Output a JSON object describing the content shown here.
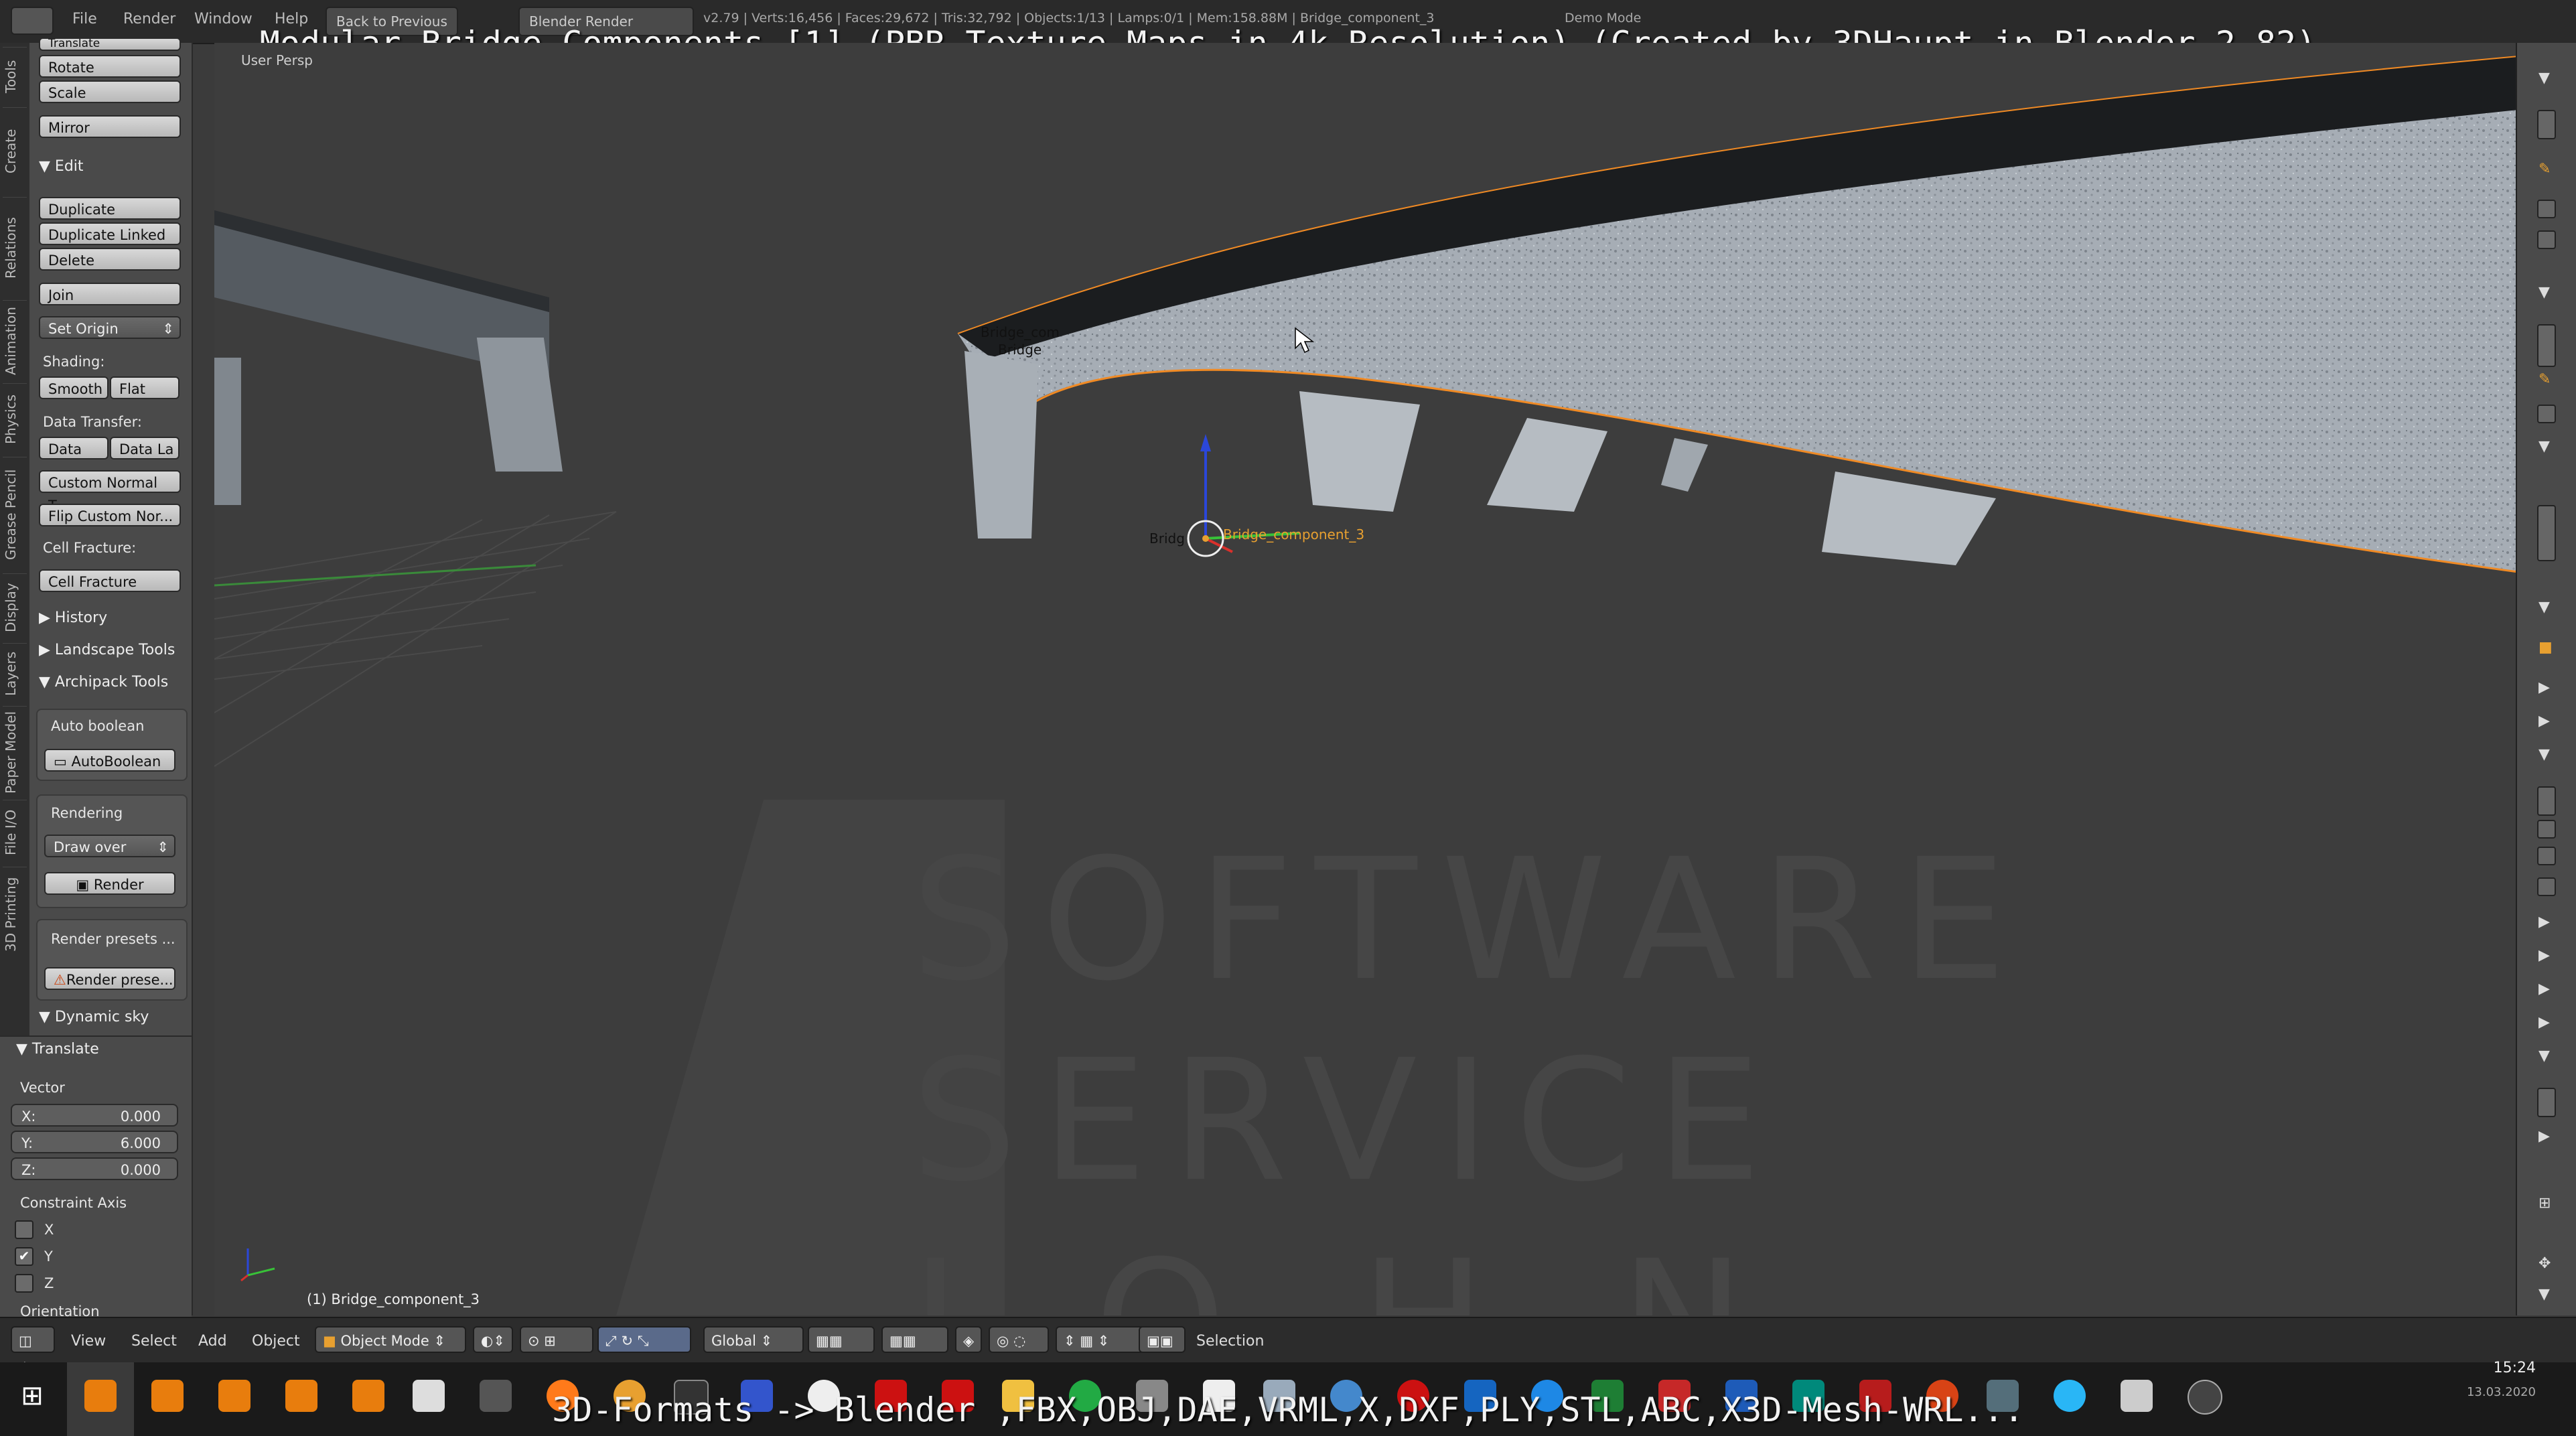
{
  "overlay": {
    "title": "Modular Bridge Components [1] (PBR Texture Maps in 4k Resolution) (Created by 3DHaupt in Blender-2.82)",
    "bottom": "3D-Formats -> Blender ,FBX,OBJ,DAE,VRML,X,DXF,PLY,STL,ABC,X3D-Mesh-WRL..."
  },
  "topbar": {
    "menus": [
      "File",
      "Render",
      "Window",
      "Help"
    ],
    "back_button": "Back to Previous",
    "engine": "Blender Render",
    "stats": "v2.79 | Verts:16,456 | Faces:29,672 | Tris:32,792 | Objects:1/13 | Lamps:0/1 | Mem:158.88M | Bridge_component_3",
    "demo_mode": "Demo Mode"
  },
  "left_tabs": [
    "Tools",
    "Create",
    "Relations",
    "Animation",
    "Physics",
    "Grease Pencil",
    "Display",
    "Layers",
    "Paper Model",
    "File I/O",
    "3D Printing"
  ],
  "toolbar": {
    "transform_partial": "Translate",
    "rotate": "Rotate",
    "scale": "Scale",
    "mirror": "Mirror",
    "edit_header": "Edit",
    "duplicate": "Duplicate",
    "duplicate_linked": "Duplicate Linked",
    "delete": "Delete",
    "join": "Join",
    "set_origin": "Set Origin",
    "shading_label": "Shading:",
    "smooth": "Smooth",
    "flat": "Flat",
    "data_transfer_label": "Data Transfer:",
    "data": "Data",
    "data_layout": "Data La",
    "custom_normal": "Custom Normal T...",
    "flip_custom": "Flip Custom Nor...",
    "cell_fracture_label": "Cell Fracture:",
    "cell_fracture": "Cell Fracture",
    "history": "History",
    "landscape_tools": "Landscape Tools",
    "archipack_tools": "Archipack Tools",
    "auto_boolean_label": "Auto boolean",
    "auto_boolean": "AutoBoolean",
    "rendering_label": "Rendering",
    "draw_over": "Draw over",
    "render": "Render",
    "render_presets_label": "Render presets ...",
    "render_presets": "Render prese...",
    "dynamic_sky": "Dynamic sky"
  },
  "operator": {
    "header": "Translate",
    "vector_label": "Vector",
    "x_label": "X:",
    "x_value": "0.000",
    "y_label": "Y:",
    "y_value": "6.000",
    "z_label": "Z:",
    "z_value": "0.000",
    "constraint_label": "Constraint Axis",
    "cx": "X",
    "cy": "Y",
    "cz": "Z",
    "cx_checked": false,
    "cy_checked": true,
    "cz_checked": false,
    "orientation_label": "Orientation"
  },
  "viewport": {
    "view_label": "User Persp",
    "object_info": "(1) Bridge_component_3",
    "label_bridge_top": "Bridge_com",
    "label_bridge_top2": "Bridge",
    "label_origin_left": "Bridg",
    "label_active": "Bridge_component_3",
    "watermark_lines": [
      "SOFTWARE",
      "SERVICE",
      "JOHN"
    ]
  },
  "header": {
    "menus": [
      "View",
      "Select",
      "Add",
      "Object"
    ],
    "mode": "Object Mode",
    "orientation": "Global",
    "status": "Selection"
  },
  "taskbar": {
    "time": "15:24",
    "date": "13.03.2020"
  },
  "colors": {
    "accent_orange": "#e8a030",
    "selection_outline": "#f08a24",
    "axis_x": "#d9302b",
    "axis_y": "#38c238",
    "axis_z": "#2b47d9"
  }
}
